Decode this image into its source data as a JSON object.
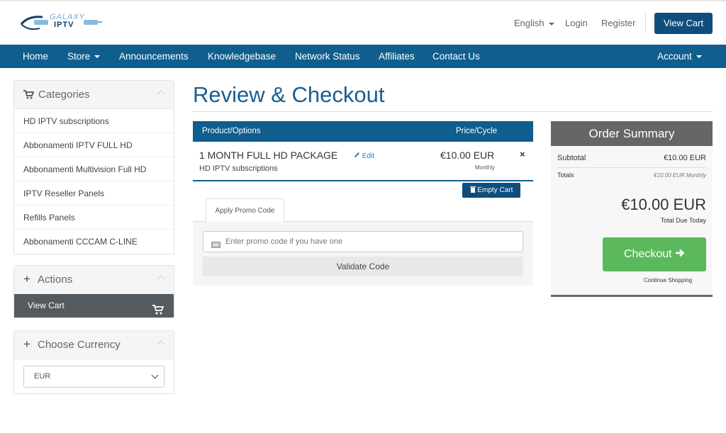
{
  "header": {
    "logo_line1": "GALAXY",
    "logo_line2": "IPTV",
    "language": "English",
    "login": "Login",
    "register": "Register",
    "view_cart": "View Cart"
  },
  "nav": {
    "items": [
      {
        "label": "Home"
      },
      {
        "label": "Store"
      },
      {
        "label": "Announcements"
      },
      {
        "label": "Knowledgebase"
      },
      {
        "label": "Network Status"
      },
      {
        "label": "Affiliates"
      },
      {
        "label": "Contact Us"
      }
    ],
    "account": "Account"
  },
  "sidebar": {
    "categories_title": "Categories",
    "categories": [
      "HD IPTV subscriptions",
      "Abbonamenti IPTV FULL HD",
      "Abbonamenti Multivision Full HD",
      "IPTV Reseller Panels",
      "Refills Panels",
      "Abbonamenti CCCAM C-LINE"
    ],
    "actions_title": "Actions",
    "actions_view_cart": "View Cart",
    "currency_title": "Choose Currency",
    "currency_selected": "EUR"
  },
  "main": {
    "title": "Review & Checkout",
    "col_product": "Product/Options",
    "col_price": "Price/Cycle",
    "product_name": "1 MONTH FULL HD PACKAGE",
    "edit": "Edit",
    "product_group": "HD IPTV subscriptions",
    "price": "€10.00 EUR",
    "cycle": "Monthly",
    "remove": "×",
    "empty_cart": "Empty Cart",
    "promo_tab": "Apply Promo Code",
    "promo_placeholder": "Enter promo code if you have one",
    "validate": "Validate Code"
  },
  "summary": {
    "title": "Order Summary",
    "subtotal_label": "Subtotal",
    "subtotal_value": "€10.00 EUR",
    "totals_label": "Totals",
    "totals_value": "€10.00 EUR Monthly",
    "total_due": "€10.00 EUR",
    "total_due_label": "Total Due Today",
    "checkout": "Checkout",
    "continue": "Continue Shopping"
  },
  "colors": {
    "navbar": "#0f5e8e",
    "primary_button": "#0f4e7c",
    "checkout": "#5cb85c",
    "summary_head": "#666666"
  }
}
